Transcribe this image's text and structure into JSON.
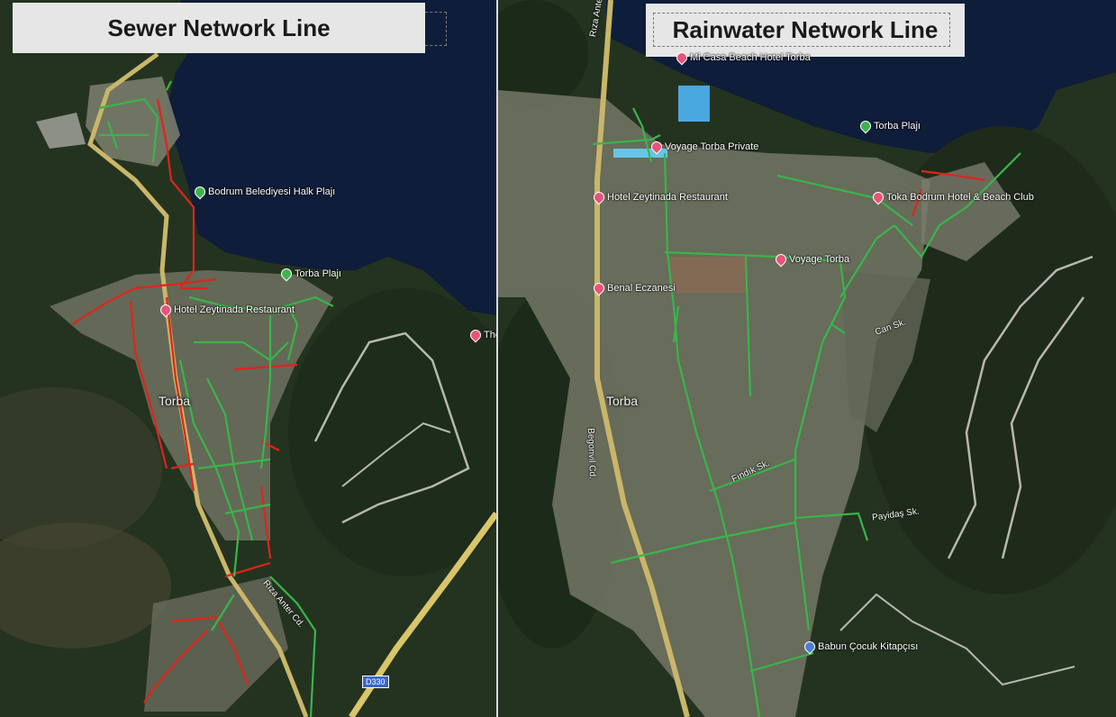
{
  "left_panel": {
    "title": "Sewer Network Line",
    "place_label": "Torba",
    "pois": [
      {
        "name": "Bodrum Belediyesi Halk Plajı",
        "icon": "beach-pin-icon",
        "color": "#3fb24f"
      },
      {
        "name": "Torba Plajı",
        "icon": "beach-pin-icon",
        "color": "#3fb24f"
      },
      {
        "name": "Hotel Zeytinada Restaurant",
        "icon": "hotel-pin-icon",
        "color": "#e8537a"
      },
      {
        "name": "Tho",
        "icon": "pin-icon",
        "color": "#e8537a"
      }
    ],
    "street_labels": [
      "Rıza Anter Cd."
    ],
    "road_shield": "D330"
  },
  "right_panel": {
    "title": "Rainwater Network Line",
    "place_label": "Torba",
    "pois": [
      {
        "name": "Mi Casa Beach Hotel Torba",
        "icon": "hotel-pin-icon",
        "color": "#e8537a"
      },
      {
        "name": "Torba Plajı",
        "icon": "beach-pin-icon",
        "color": "#3fb24f"
      },
      {
        "name": "Voyage Torba Private",
        "icon": "hotel-pin-icon",
        "color": "#e8537a"
      },
      {
        "name": "Hotel Zeytinada Restaurant",
        "icon": "hotel-pin-icon",
        "color": "#e8537a"
      },
      {
        "name": "Toka Bodrum Hotel & Beach Club",
        "icon": "hotel-pin-icon",
        "color": "#e8537a"
      },
      {
        "name": "Voyage Torba",
        "icon": "hotel-pin-icon",
        "color": "#e8537a"
      },
      {
        "name": "Benal Eczanesi",
        "icon": "pharmacy-pin-icon",
        "color": "#e8537a"
      },
      {
        "name": "Babun Çocuk Kitapçısı",
        "icon": "bookstore-pin-icon",
        "color": "#4a7fd6"
      }
    ],
    "street_labels": [
      "Rıza Anter Cd.",
      "Begonvil Cd.",
      "Can Sk.",
      "Fındık Sk.",
      "Payidaş Sk."
    ]
  },
  "colors": {
    "sewer_red": "#e0241b",
    "network_green": "#39b54a",
    "sea": "#0e1d3a",
    "forest": "#1f2e1c",
    "urban": "#7e8070",
    "road_main": "#c9b66a",
    "road_minor": "#b8b8b0"
  }
}
